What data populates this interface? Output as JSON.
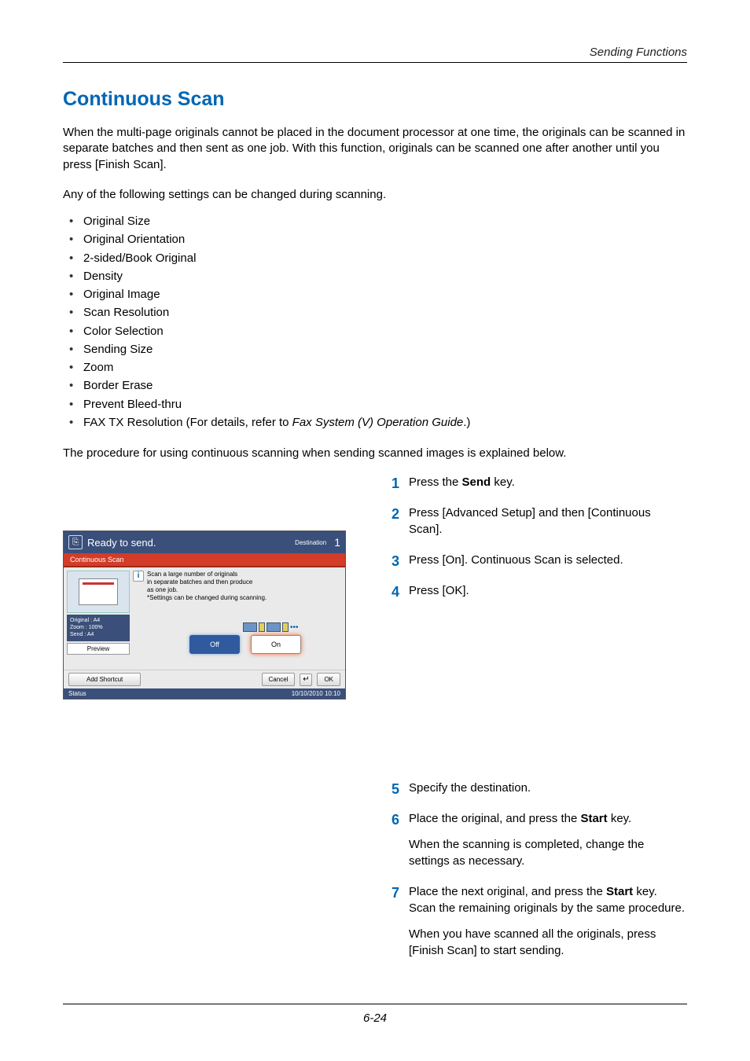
{
  "header": {
    "running": "Sending Functions"
  },
  "title": "Continuous Scan",
  "intro": "When the multi-page originals cannot be placed in the document processor at one time, the originals can be scanned in separate batches and then sent as one job. With this function, originals can be scanned one after another until you press [Finish Scan].",
  "settings_intro": "Any of the following settings can be changed during scanning.",
  "settings": [
    "Original Size",
    "Original Orientation",
    "2-sided/Book Original",
    "Density",
    "Original Image",
    "Scan Resolution",
    "Color Selection",
    "Sending Size",
    "Zoom",
    "Border Erase",
    "Prevent Bleed-thru"
  ],
  "fax_line": {
    "prefix": "FAX TX Resolution (For details, refer to ",
    "italic": "Fax System (V) Operation Guide",
    "suffix": ".)"
  },
  "procedure_intro": "The procedure for using continuous scanning when sending scanned images is explained below.",
  "steps": {
    "s1": {
      "num": "1",
      "t1": "Press the ",
      "bold": "Send",
      "t2": " key."
    },
    "s2": {
      "num": "2",
      "text": "Press [Advanced Setup] and then [Continuous Scan]."
    },
    "s3": {
      "num": "3",
      "text": "Press [On]. Continuous Scan is selected."
    },
    "s4": {
      "num": "4",
      "text": "Press [OK]."
    },
    "s5": {
      "num": "5",
      "text": "Specify the destination."
    },
    "s6": {
      "num": "6",
      "t1": "Place the original, and press the ",
      "bold": "Start",
      "t2": " key.",
      "sub": "When the scanning is completed, change the settings as necessary."
    },
    "s7": {
      "num": "7",
      "t1": "Place the next original, and press the ",
      "bold": "Start",
      "t2": " key. Scan the remaining originals by the same procedure.",
      "sub": "When you have scanned all the originals, press [Finish Scan] to start sending."
    }
  },
  "panel": {
    "header_title": "Ready to send.",
    "destination": "Destination",
    "count": "1",
    "tab": "Continuous Scan",
    "info": "Scan a large number of originals\nin separate batches and then produce\nas one job.\n*Settings can be changed during scanning.",
    "off": "Off",
    "on": "On",
    "side": {
      "original_k": "Original",
      "original_v": ": A4",
      "zoom_k": "Zoom",
      "zoom_v": ": 100%",
      "send_k": "Send",
      "send_v": ": A4",
      "preview": "Preview"
    },
    "add_shortcut": "Add Shortcut",
    "cancel": "Cancel",
    "back": "↵",
    "ok": "OK",
    "status": "Status",
    "datetime": "10/10/2010  10:10"
  },
  "footer": "6-24"
}
